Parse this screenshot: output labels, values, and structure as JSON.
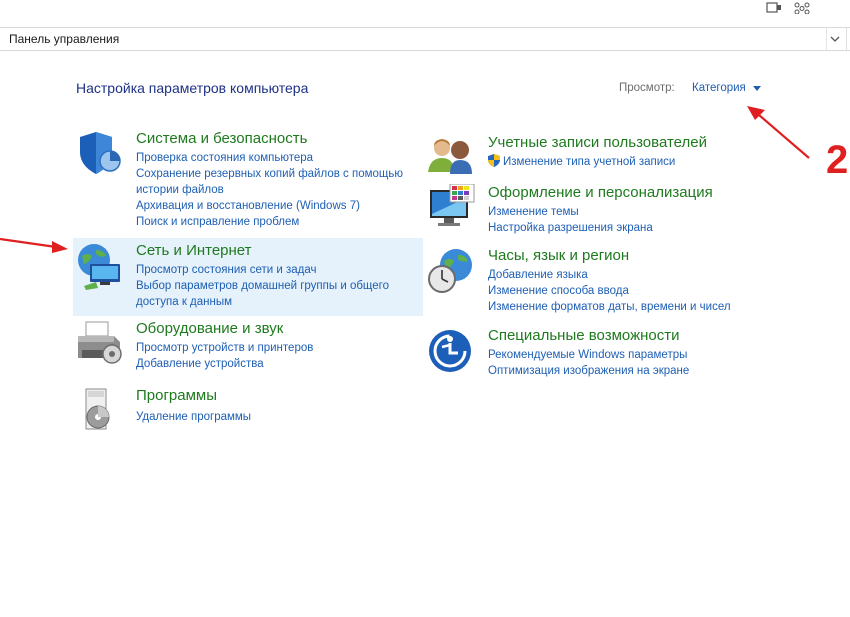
{
  "address": {
    "path": "Панель управления"
  },
  "header": {
    "title": "Настройка параметров компьютера",
    "view_label": "Просмотр:",
    "view_value": "Категория"
  },
  "left_categories": [
    {
      "title": "Система и безопасность",
      "icon": "shield-icon",
      "links": [
        "Проверка состояния компьютера",
        "Сохранение резервных копий файлов с помощью истории файлов",
        "Архивация и восстановление (Windows 7)",
        "Поиск и исправление проблем"
      ]
    },
    {
      "title": "Сеть и Интернет",
      "icon": "network-globe-icon",
      "links": [
        "Просмотр состояния сети и задач",
        "Выбор параметров домашней группы и общего доступа к данным"
      ]
    },
    {
      "title": "Оборудование и звук",
      "icon": "printer-icon",
      "links": [
        "Просмотр устройств и принтеров",
        "Добавление устройства"
      ]
    },
    {
      "title": "Программы",
      "icon": "programs-disc-icon",
      "links": [
        "Удаление программы"
      ]
    }
  ],
  "right_categories": [
    {
      "title": "Учетные записи пользователей",
      "icon": "users-icon",
      "links": [
        "Изменение типа учетной записи"
      ]
    },
    {
      "title": "Оформление и персонализация",
      "icon": "monitor-palette-icon",
      "links": [
        "Изменение темы",
        "Настройка разрешения экрана"
      ]
    },
    {
      "title": "Часы, язык и регион",
      "icon": "clock-globe-icon",
      "links": [
        "Добавление языка",
        "Изменение способа ввода",
        "Изменение форматов даты, времени и чисел"
      ]
    },
    {
      "title": "Специальные возможности",
      "icon": "accessibility-icon",
      "links": [
        "Рекомендуемые Windows параметры",
        "Оптимизация изображения на экране"
      ]
    }
  ],
  "annotations": {
    "marker": "2"
  },
  "colors": {
    "title_green": "#1f7a1f",
    "link_blue": "#1e5fb4",
    "heading_blue": "#1e3287",
    "highlight": "#e5f1fb",
    "annotation_red": "#e02020"
  }
}
